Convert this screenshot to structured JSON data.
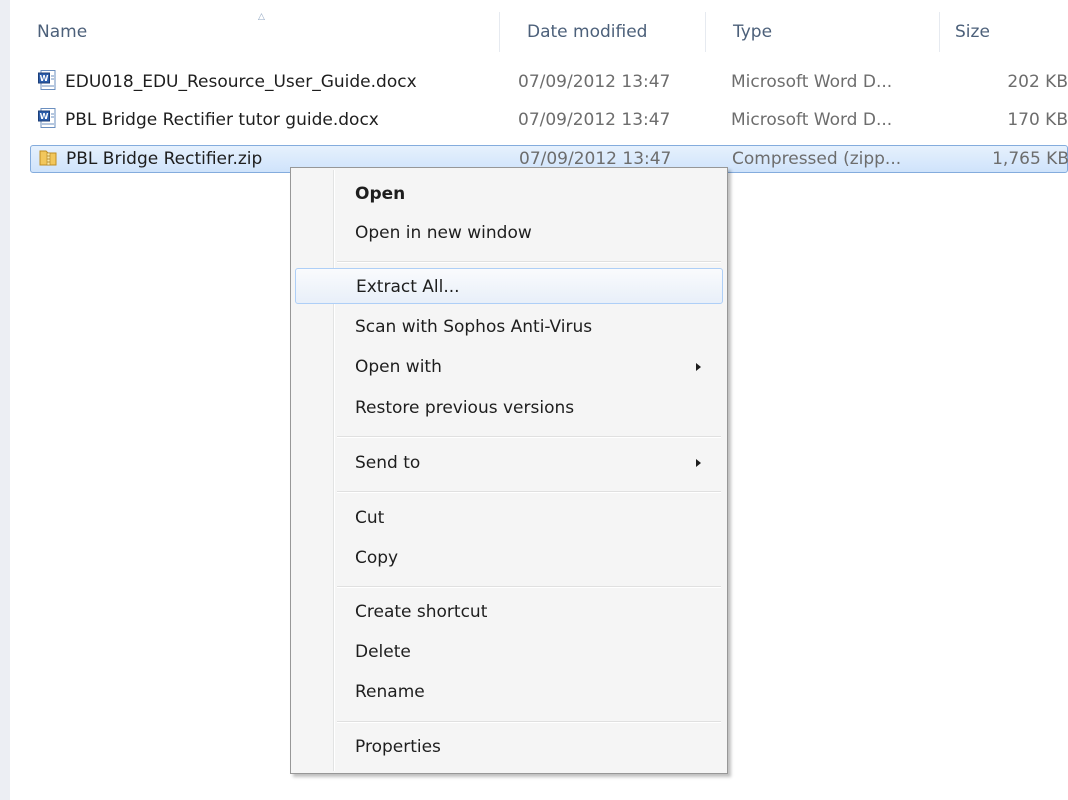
{
  "columns": {
    "name": "Name",
    "date": "Date modified",
    "type": "Type",
    "size": "Size"
  },
  "files": [
    {
      "name": "EDU018_EDU_Resource_User_Guide.docx",
      "date": "07/09/2012 13:47",
      "type": "Microsoft Word D...",
      "size": "202 KB",
      "icon": "word-document-icon"
    },
    {
      "name": "PBL Bridge Rectifier tutor guide.docx",
      "date": "07/09/2012 13:47",
      "type": "Microsoft Word D...",
      "size": "170 KB",
      "icon": "word-document-icon"
    },
    {
      "name": "PBL Bridge Rectifier.zip",
      "date": "07/09/2012 13:47",
      "type": "Compressed (zipp...",
      "size": "1,765 KB",
      "icon": "zip-folder-icon",
      "selected": true
    }
  ],
  "context_menu": {
    "items": [
      {
        "label": "Open",
        "bold": true
      },
      {
        "label": "Open in new window"
      },
      {
        "label": "Extract All...",
        "hover": true
      },
      {
        "label": "Scan with Sophos Anti-Virus"
      },
      {
        "label": "Open with",
        "submenu": true
      },
      {
        "label": "Restore previous versions"
      },
      {
        "label": "Send to",
        "submenu": true
      },
      {
        "label": "Cut"
      },
      {
        "label": "Copy"
      },
      {
        "label": "Create shortcut"
      },
      {
        "label": "Delete"
      },
      {
        "label": "Rename"
      },
      {
        "label": "Properties"
      }
    ]
  },
  "colors": {
    "selection": "#cfe3fb",
    "selection_border": "#84acdd",
    "header_text": "#4c607a",
    "menu_background": "#f5f5f5"
  }
}
